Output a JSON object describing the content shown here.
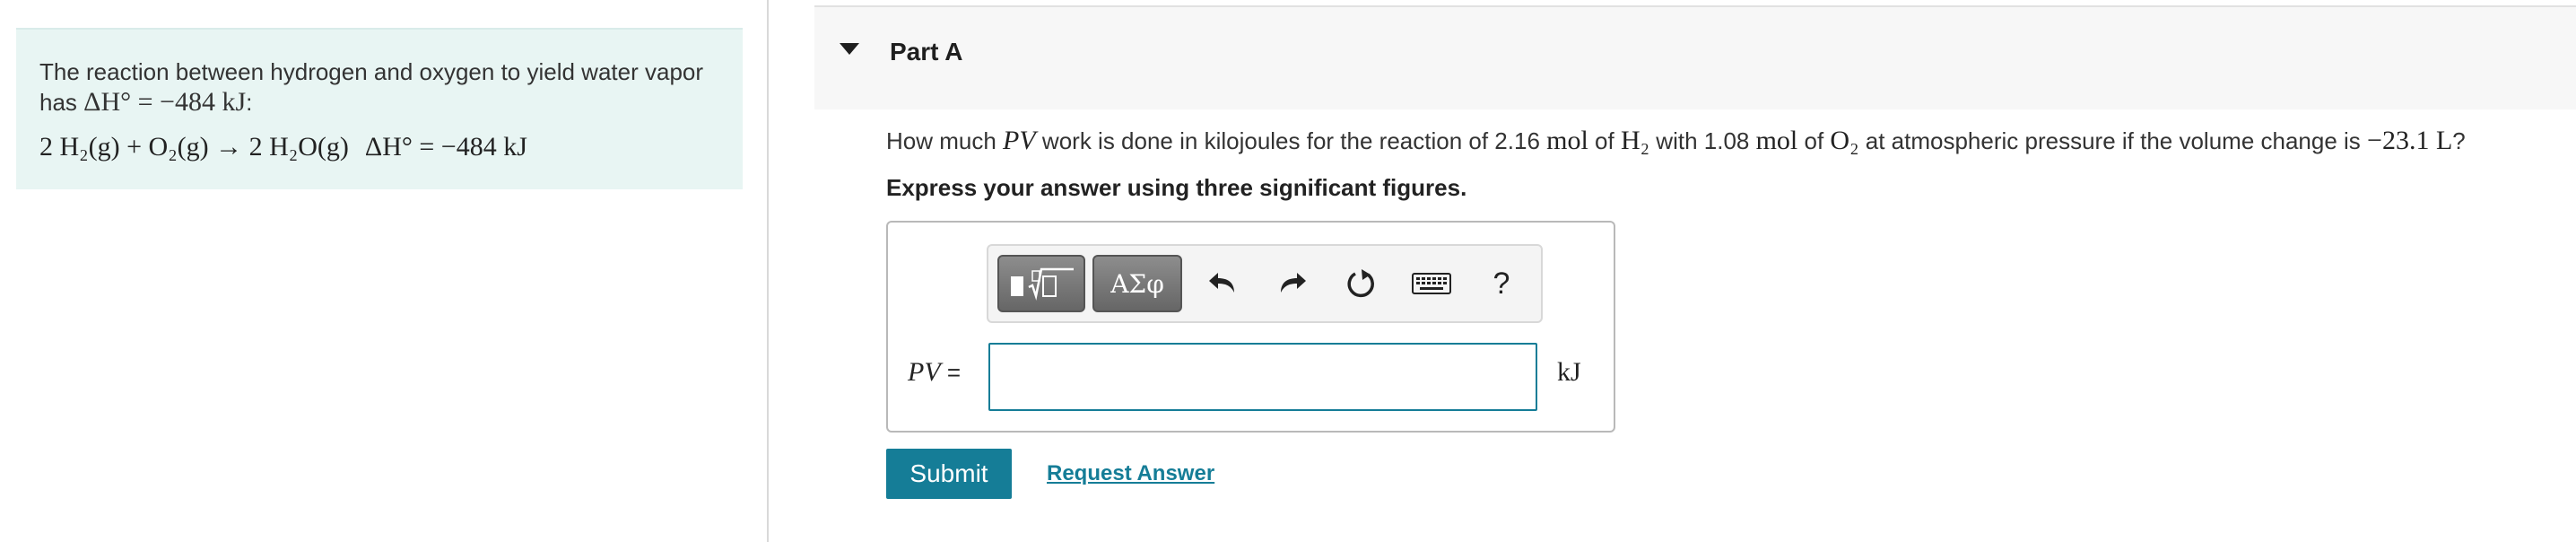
{
  "intro": {
    "text_prefix": "The reaction between hydrogen and oxygen to yield water vapor has ",
    "text_enthalpy": "ΔH° = −484 kJ",
    "text_suffix": ":",
    "equation_reaction": "2 H₂(g) + O₂(g) → 2 H₂O(g)",
    "equation_enthalpy": "ΔH° = −484 kJ"
  },
  "part": {
    "title": "Part A",
    "question_parts": [
      "How much ",
      "PV",
      " work is done in kilojoules for the reaction of 2.16 ",
      "mol",
      " of ",
      "H₂",
      " with 1.08 ",
      "mol",
      " of ",
      "O₂",
      " at atmospheric pressure if the volume change is ",
      "−23.1 L",
      "?"
    ],
    "instruction": "Express your answer using three significant figures."
  },
  "toolbar": {
    "greek_label": "ΑΣφ",
    "help_label": "?"
  },
  "answer": {
    "label": "PV",
    "equals": " =",
    "value": "",
    "unit": "kJ"
  },
  "actions": {
    "submit_label": "Submit",
    "request_answer_label": "Request Answer"
  },
  "colors": {
    "accent": "#157d97",
    "intro_bg": "#e8f5f3",
    "header_bg": "#f7f7f7"
  }
}
